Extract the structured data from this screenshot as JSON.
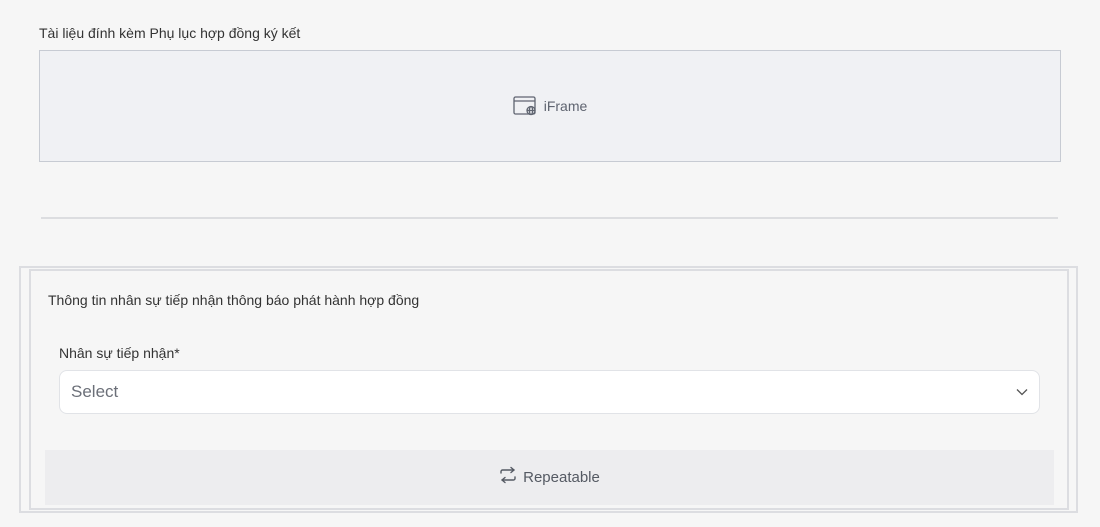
{
  "attachment": {
    "label": "Tài liệu đính kèm Phụ lục hợp đồng ký kết",
    "iframe_placeholder": "iFrame",
    "icon": "browser-globe-icon"
  },
  "section": {
    "title": "Thông tin nhân sự tiếp nhận thông báo phát hành hợp đồng",
    "field": {
      "label": "Nhân sự tiếp nhận*",
      "selected_value": "Select",
      "icon": "chevron-down-icon"
    },
    "repeatable": {
      "label": "Repeatable",
      "icon": "repeat-icon"
    }
  },
  "colors": {
    "background": "#f6f6f6",
    "iframe_bg": "#f0f1f4",
    "border": "#c7cbd3",
    "select_bg": "#ffffff",
    "repeatable_bg": "#ededef"
  }
}
